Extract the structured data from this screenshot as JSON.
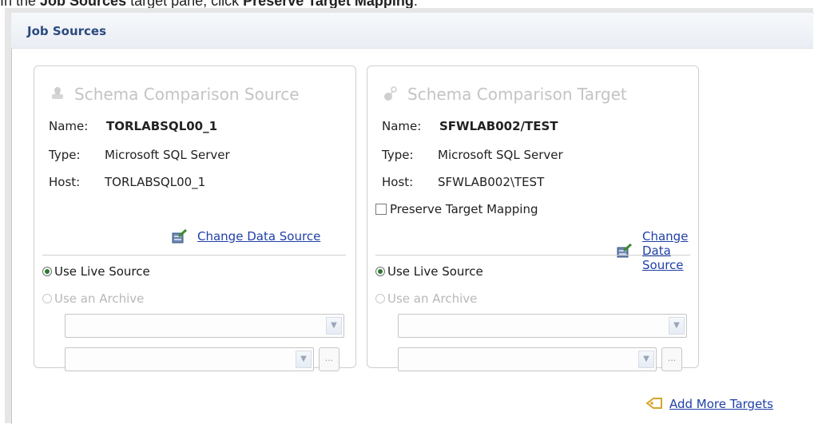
{
  "instruction": {
    "prefix": "In the ",
    "strong1": "Job Sources",
    "middle": " target pane, click ",
    "strong2": "Preserve Target Mapping",
    "suffix": "."
  },
  "panel": {
    "title": "Job Sources"
  },
  "source": {
    "title": "Schema Comparison Source",
    "name_label": "Name:",
    "name_value": "TORLABSQL00_1",
    "type_label": "Type:",
    "type_value": "Microsoft SQL Server",
    "host_label": "Host:",
    "host_value": "TORLABSQL00_1",
    "change_link": "Change Data Source",
    "live_label": "Use Live Source",
    "archive_label": "Use an Archive",
    "browse_label": "..."
  },
  "target": {
    "title": "Schema Comparison Target",
    "name_label": "Name:",
    "name_value": "SFWLAB002/TEST",
    "type_label": "Type:",
    "type_value": "Microsoft SQL Server",
    "host_label": "Host:",
    "host_value": "SFWLAB002\\TEST",
    "preserve_label": "Preserve Target Mapping",
    "change_link": "Change Data Source",
    "live_label": "Use Live Source",
    "archive_label": "Use an Archive",
    "browse_label": "..."
  },
  "add_more": "Add More Targets",
  "colors": {
    "link": "#1f3fa8",
    "header_title": "#2a4a7f",
    "disabled": "#b8b8b8",
    "radio_dot": "#2d7a2d"
  }
}
